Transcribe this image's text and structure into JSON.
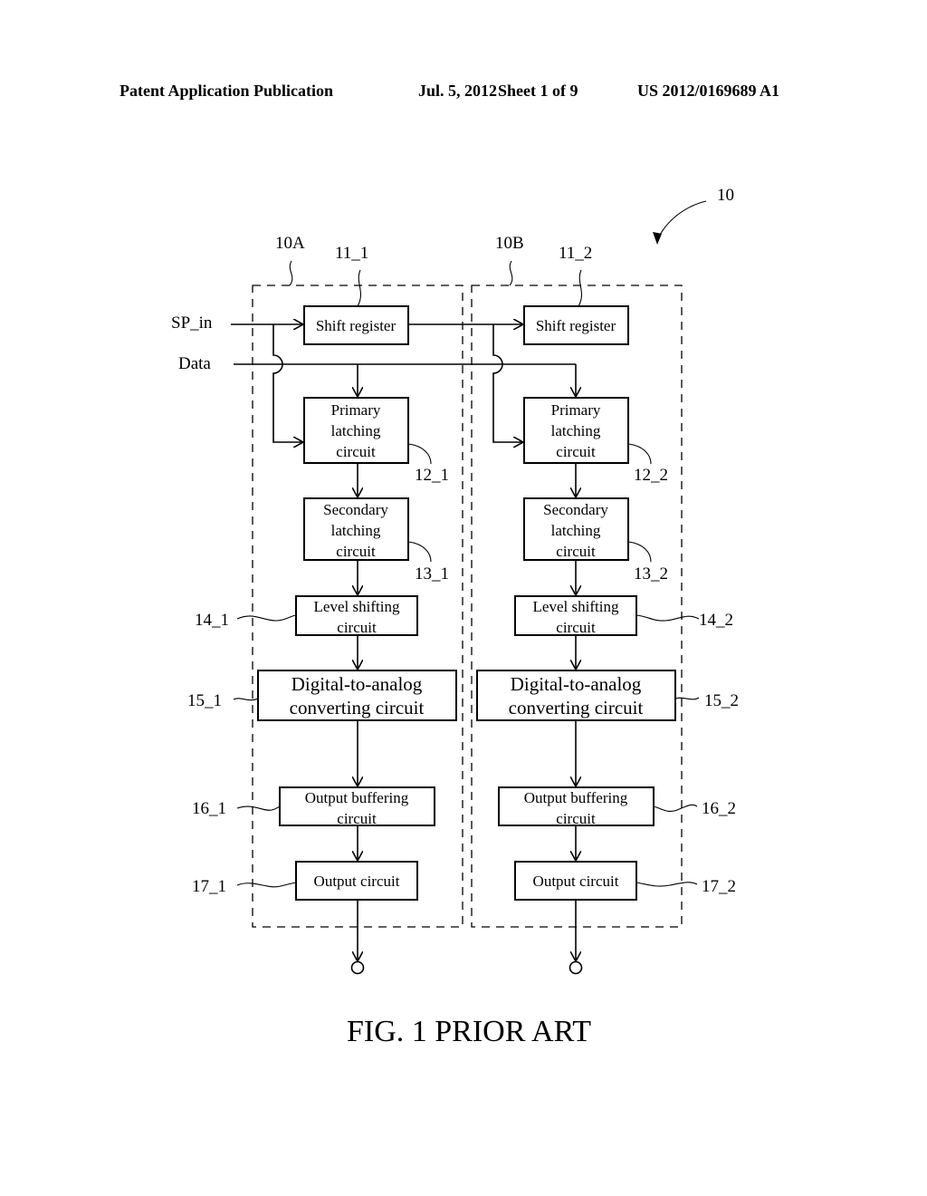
{
  "header": {
    "publication": "Patent Application Publication",
    "date": "Jul. 5, 2012",
    "sheet": "Sheet 1 of 9",
    "number": "US 2012/0169689 A1"
  },
  "figure": {
    "caption": "FIG. 1 PRIOR ART",
    "ref_overall": "10",
    "inputs": {
      "sp_in": "SP_in",
      "data": "Data"
    },
    "channels": [
      {
        "ref": "10A",
        "blocks": {
          "shift_register": {
            "ref": "11_1",
            "lines": [
              "Shift register"
            ]
          },
          "primary_latch": {
            "ref": "12_1",
            "lines": [
              "Primary",
              "latching",
              "circuit"
            ]
          },
          "secondary_latch": {
            "ref": "13_1",
            "lines": [
              "Secondary",
              "latching",
              "circuit"
            ]
          },
          "level_shifter": {
            "ref": "14_1",
            "lines": [
              "Level shifting",
              "circuit"
            ]
          },
          "dac": {
            "ref": "15_1",
            "lines": [
              "Digital-to-analog",
              "converting circuit"
            ]
          },
          "output_buffer": {
            "ref": "16_1",
            "lines": [
              "Output buffering",
              "circuit"
            ]
          },
          "output_circuit": {
            "ref": "17_1",
            "lines": [
              "Output circuit"
            ]
          }
        }
      },
      {
        "ref": "10B",
        "blocks": {
          "shift_register": {
            "ref": "11_2",
            "lines": [
              "Shift register"
            ]
          },
          "primary_latch": {
            "ref": "12_2",
            "lines": [
              "Primary",
              "latching",
              "circuit"
            ]
          },
          "secondary_latch": {
            "ref": "13_2",
            "lines": [
              "Secondary",
              "latching",
              "circuit"
            ]
          },
          "level_shifter": {
            "ref": "14_2",
            "lines": [
              "Level shifting",
              "circuit"
            ]
          },
          "dac": {
            "ref": "15_2",
            "lines": [
              "Digital-to-analog",
              "converting circuit"
            ]
          },
          "output_buffer": {
            "ref": "16_2",
            "lines": [
              "Output buffering",
              "circuit"
            ]
          },
          "output_circuit": {
            "ref": "17_2",
            "lines": [
              "Output circuit"
            ]
          }
        }
      }
    ]
  }
}
